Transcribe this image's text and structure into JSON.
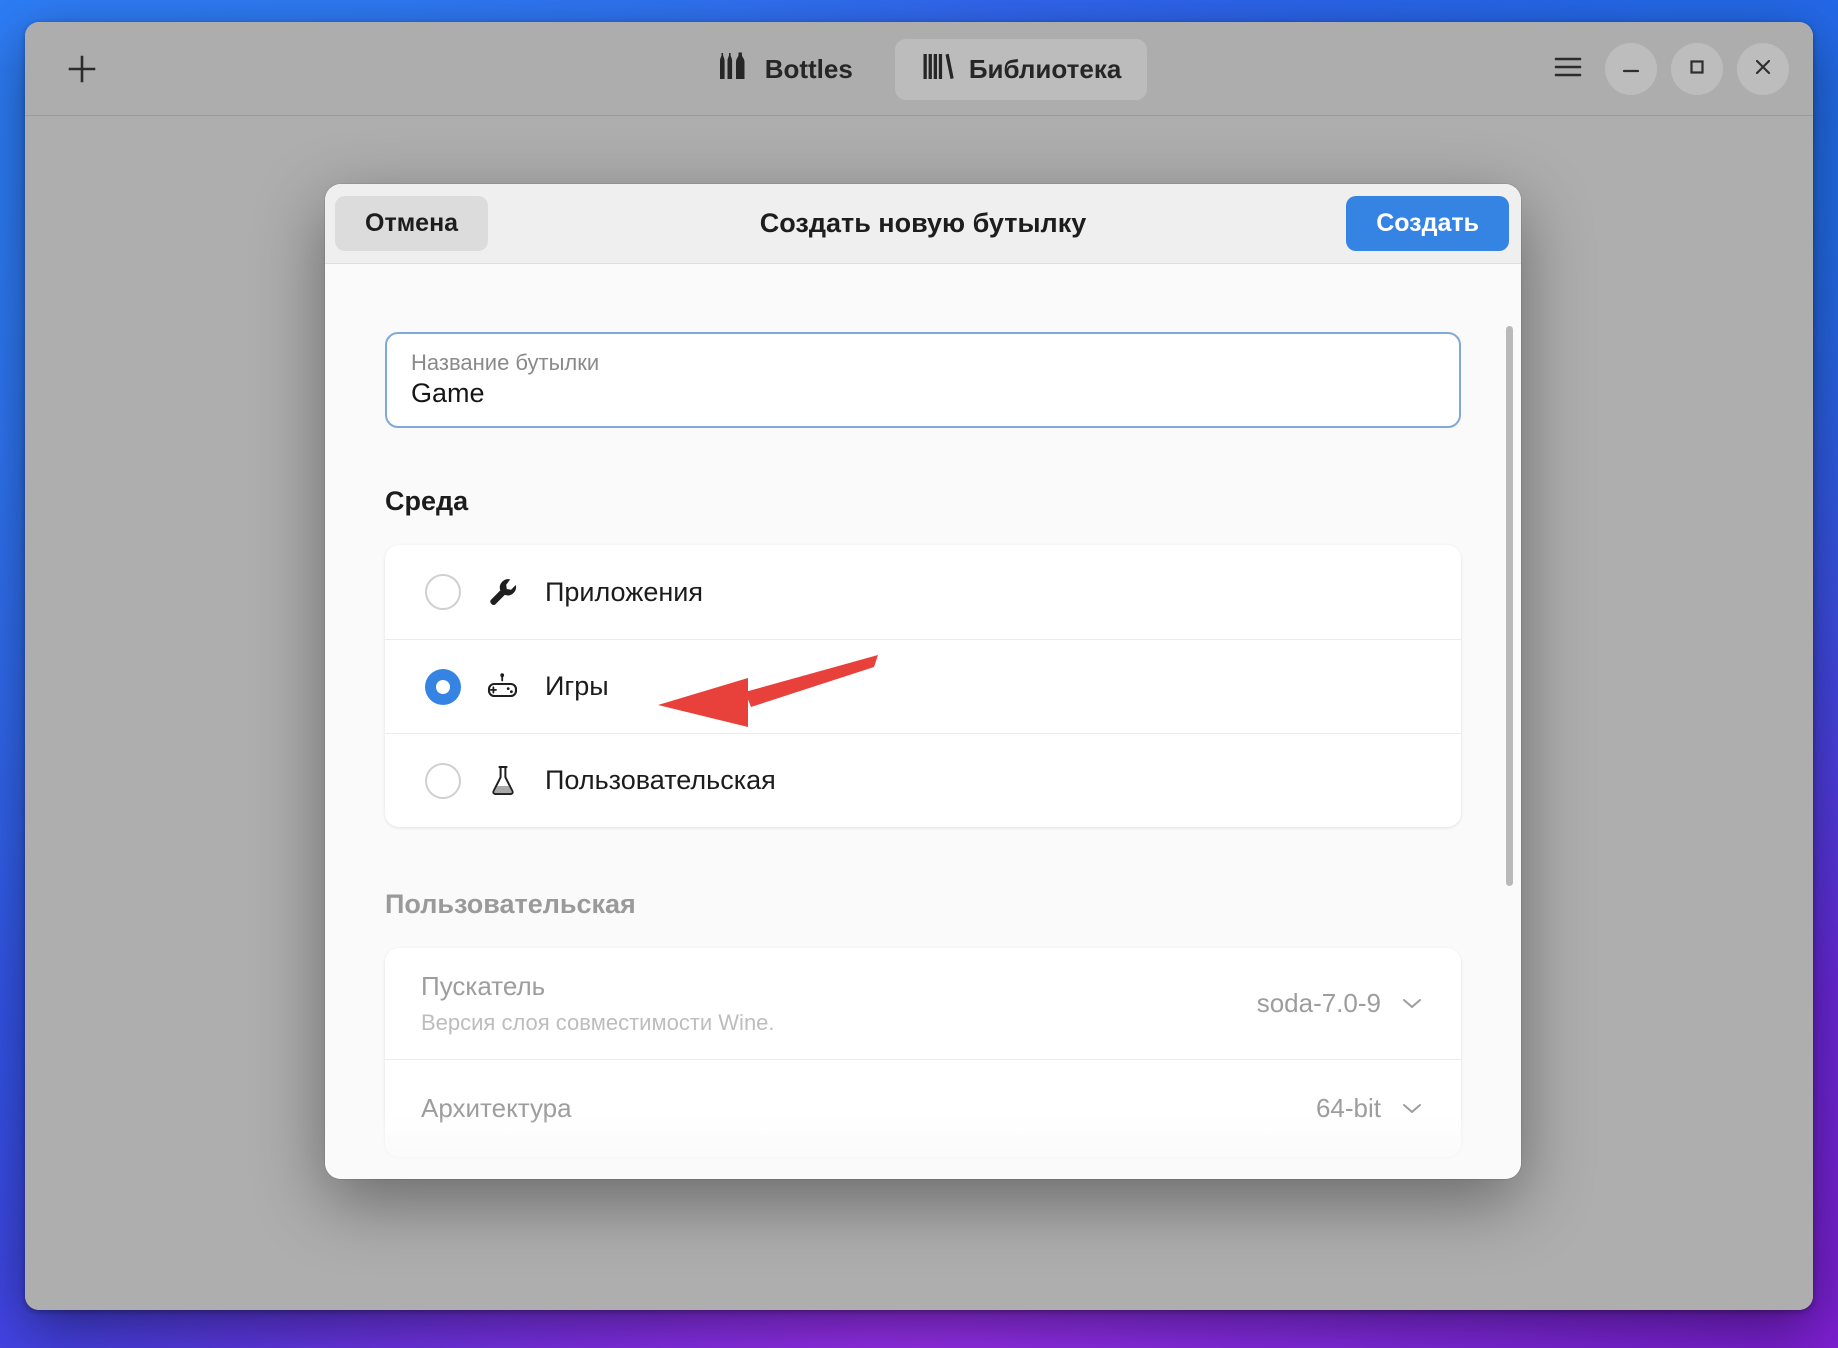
{
  "window": {
    "new_tab_label": "+",
    "tabs": [
      {
        "label": "Bottles",
        "icon": "bottles-icon",
        "selected": false
      },
      {
        "label": "Библиотека",
        "icon": "library-books-icon",
        "selected": true
      }
    ],
    "controls": {
      "menu": "☰",
      "minimize": "−",
      "maximize": "□",
      "close": "✕"
    }
  },
  "dialog": {
    "title": "Создать новую бутылку",
    "cancel_label": "Отмена",
    "create_label": "Создать",
    "name_field": {
      "label": "Название бутылки",
      "value": "Game"
    },
    "environment": {
      "heading": "Среда",
      "options": [
        {
          "label": "Приложения",
          "icon": "wrench-icon",
          "selected": false
        },
        {
          "label": "Игры",
          "icon": "gamepad-icon",
          "selected": true
        },
        {
          "label": "Пользовательская",
          "icon": "flask-icon",
          "selected": false
        }
      ]
    },
    "custom_section": {
      "heading": "Пользовательская",
      "rows": [
        {
          "title": "Пускатель",
          "subtitle": "Версия слоя совместимости Wine.",
          "value": "soda-7.0-9"
        },
        {
          "title": "Архитектура",
          "subtitle": "",
          "value": "64-bit"
        }
      ]
    }
  },
  "colors": {
    "accent": "#3584e4",
    "annotation": "#e8403a",
    "window_bg": "#aeaeae",
    "dialog_bg": "#fafafa"
  }
}
